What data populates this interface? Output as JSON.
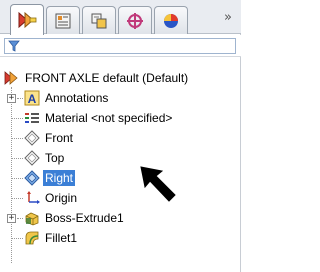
{
  "panel": {
    "tabs": [
      {
        "name": "featuremanager",
        "active": true
      },
      {
        "name": "propertymanager",
        "active": false
      },
      {
        "name": "configurationmanager",
        "active": false
      },
      {
        "name": "dimxpertmanager",
        "active": false
      },
      {
        "name": "displaymanager",
        "active": false
      }
    ],
    "overflow_label": "»"
  },
  "tree": {
    "root": {
      "label": "FRONT AXLE default (Default)",
      "icon": "part-icon"
    },
    "items": [
      {
        "label": "Annotations",
        "icon": "annotations-icon",
        "expander": "+"
      },
      {
        "label": "Material <not specified>",
        "icon": "material-icon"
      },
      {
        "label": "Front",
        "icon": "plane-icon"
      },
      {
        "label": "Top",
        "icon": "plane-icon"
      },
      {
        "label": "Right",
        "icon": "plane-icon",
        "selected": true
      },
      {
        "label": "Origin",
        "icon": "origin-icon"
      },
      {
        "label": "Boss-Extrude1",
        "icon": "extrude-icon",
        "expander": "+"
      },
      {
        "label": "Fillet1",
        "icon": "fillet-icon"
      }
    ]
  },
  "colors": {
    "selection": "#3b7fd6",
    "tab_border": "#9aa3ae"
  }
}
